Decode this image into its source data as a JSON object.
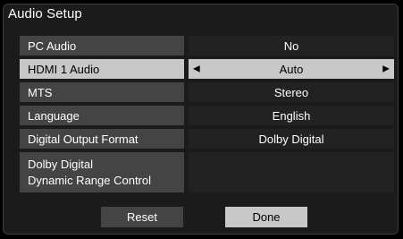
{
  "title": "Audio Setup",
  "rows": [
    {
      "label": "PC Audio",
      "value": "No"
    },
    {
      "label": "HDMI 1 Audio",
      "value": "Auto",
      "selected": true
    },
    {
      "label": "MTS",
      "value": "Stereo"
    },
    {
      "label": "Language",
      "value": "English"
    },
    {
      "label": "Digital Output Format",
      "value": "Dolby Digital"
    },
    {
      "label_line1": "Dolby Digital",
      "label_line2": "Dynamic Range Control",
      "value": ""
    }
  ],
  "arrows": {
    "left": "◀",
    "right": "▶"
  },
  "buttons": {
    "reset": "Reset",
    "done": "Done"
  }
}
